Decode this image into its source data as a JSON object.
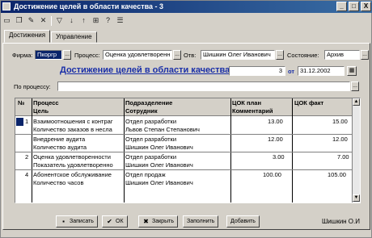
{
  "window": {
    "title": "Достижение целей в области качества - 3",
    "controls": [
      "_",
      "□",
      "X"
    ]
  },
  "toolbar": {
    "icons": [
      "new-icon",
      "copy-icon",
      "edit-icon",
      "delete-icon",
      "filter-icon",
      "sort-down-icon",
      "sort-up-icon",
      "tree-icon",
      "help-icon",
      "list-icon"
    ]
  },
  "tabs": [
    {
      "label": "Достижения"
    },
    {
      "label": "Управление"
    }
  ],
  "form": {
    "firm_label": "Фирма:",
    "firm_value": "Пкоргр",
    "process_label": "Процесс:",
    "process_value": "Оценка удовлетворенн",
    "resp_label": "Отв:",
    "resp_value": "Шишкин Олег Иванович",
    "status_label": "Состояние:",
    "status_value": "Архив",
    "doc_title": "Достижение целей в области качества №",
    "doc_number": "3",
    "date_label": "от",
    "date_value": "31.12.2002",
    "by_process_label": "По процессу:",
    "by_process_value": ""
  },
  "grid": {
    "col_num": "№",
    "col_process": "Процесс",
    "col_goal": "Цель",
    "col_dept": "Подразделение",
    "col_employee": "Сотрудник",
    "col_plan": "ЦОК план",
    "col_comment": "Комментарий",
    "col_fact": "ЦОК факт",
    "rows": [
      {
        "num": "1",
        "process": "Взаимоотношения с контраг",
        "goal": "Количество заказов в несла",
        "dept": "Отдел разработки",
        "employee": "Львов Степан Степанович",
        "plan": "13.00",
        "fact": "15.00"
      },
      {
        "num": "",
        "process": "Внедрение аудита",
        "goal": "Количество аудита",
        "dept": "Отдел разработки",
        "employee": "Шишкин Олег Иванович",
        "plan": "12.00",
        "fact": "12.00"
      },
      {
        "num": "2",
        "process": "Оценка удовлетворенности",
        "goal": "Показатель удовлетворенно",
        "dept": "Отдел разработки",
        "employee": "Шишкин Олег Иванович",
        "plan": "3.00",
        "fact": "7.00"
      },
      {
        "num": "4",
        "process": "Абонентское обслуживание",
        "goal": "Количество часов",
        "dept": "Отдел продаж",
        "employee": "Шишкин Олег Иванович",
        "plan": "100.00",
        "fact": "105.00"
      }
    ]
  },
  "buttons": {
    "write": "Записать",
    "ok": "ОК",
    "close": "Закрыть",
    "fill": "Заполнить",
    "edit": "Добавить"
  },
  "footer_user": "Шишкин О.И"
}
